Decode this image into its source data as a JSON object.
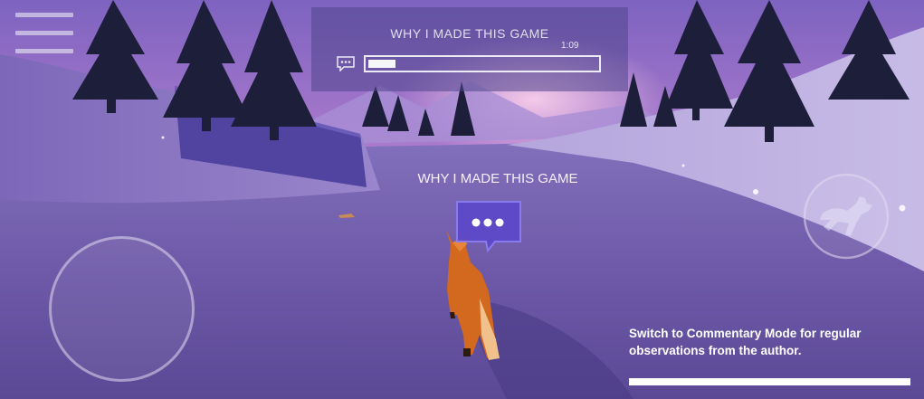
{
  "menu": {
    "icon": "hamburger-menu-icon"
  },
  "commentary_panel": {
    "title": "WHY I MADE THIS GAME",
    "time": "1:09",
    "progress": 0.12,
    "bubble_icon": "speech-bubble-icon"
  },
  "world": {
    "label": "WHY I MADE THIS GAME",
    "marker_icon": "speech-bubble-icon"
  },
  "controls": {
    "joystick_icon": "virtual-joystick",
    "jump_icon": "fox-jump-icon"
  },
  "tip": {
    "text": "Switch to Commentary Mode for regular observations from the author."
  },
  "colors": {
    "snow": "#6e5aa8",
    "sky_pink": "#d490c8",
    "panel": "#50468c",
    "fox": "#d2691e"
  }
}
